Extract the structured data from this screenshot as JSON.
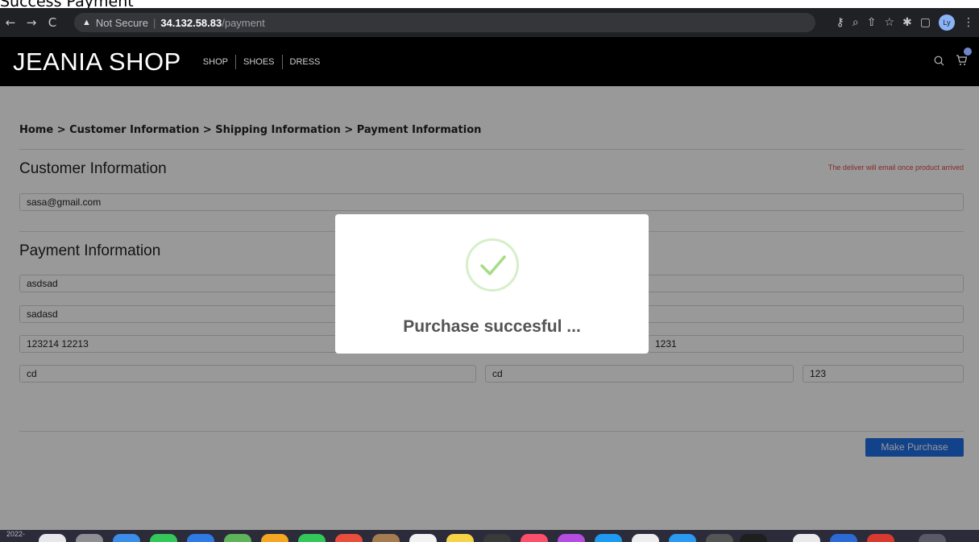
{
  "caption": "Success Payment",
  "browser": {
    "security_label": "Not Secure",
    "url_host": "34.132.58.83",
    "url_path": "/payment",
    "profile_initials": "Ly"
  },
  "site": {
    "logo": "JEANIA SHOP",
    "nav": [
      "SHOP",
      "SHOES",
      "DRESS"
    ]
  },
  "breadcrumb": "Home > Customer Information > Shipping Information > Payment Information",
  "customer": {
    "title": "Customer Information",
    "note": "The deliver will email once product arrived",
    "email": "sasa@gmail.com"
  },
  "payment": {
    "title": "Payment Information",
    "row1": "asdsad",
    "row2": "sadasd",
    "card_number": "123214 12213",
    "card_right": "1231",
    "city": "cd",
    "state": "cd",
    "zip": "123"
  },
  "purchase_button": "Make Purchase",
  "modal": {
    "title": "Purchase succesful ..."
  },
  "dock": {
    "year": "2022-"
  },
  "colors": {
    "accent": "#1e6ee6",
    "success": "#a5dc86",
    "note": "#e04848"
  }
}
